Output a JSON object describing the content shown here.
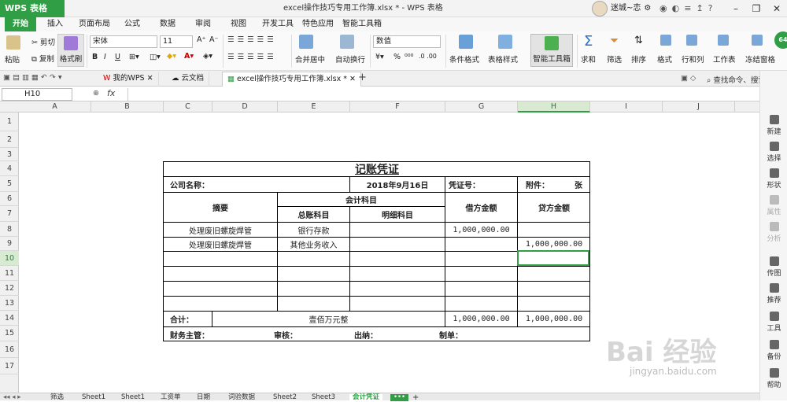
{
  "app": {
    "logo": "WPS 表格",
    "title": "excel操作技巧专用工作簿.xlsx * - WPS 表格",
    "user": "迷城~恋",
    "badge": "64"
  },
  "menu": [
    "开始",
    "插入",
    "页面布局",
    "公式",
    "数据",
    "审阅",
    "视图",
    "开发工具",
    "特色应用",
    "智能工具箱"
  ],
  "ribbon": {
    "paste": "粘贴",
    "cut": "剪切",
    "copy": "复制",
    "format_painter": "格式刷",
    "font_name": "宋体",
    "font_size": "11",
    "merge": "合并居中",
    "wrap": "自动换行",
    "number_format": "数值",
    "cond_format": "条件格式",
    "table_style": "表格样式",
    "smart_toolbox": "智能工具箱",
    "sum": "求和",
    "filter": "筛选",
    "sort": "排序",
    "format": "格式",
    "rowcol": "行和列",
    "worksheet": "工作表",
    "freeze": "冻结窗格"
  },
  "quicktabs": [
    "我的WPS",
    "云文档",
    "excel操作技巧专用工作簿.xlsx *"
  ],
  "search": "查找命令、搜索...",
  "formula": {
    "namebox": "H10",
    "fx": "fx"
  },
  "columns": [
    "A",
    "B",
    "C",
    "D",
    "E",
    "F",
    "G",
    "H",
    "I",
    "J"
  ],
  "rows": [
    "1",
    "2",
    "3",
    "4",
    "5",
    "6",
    "7",
    "8",
    "9",
    "10",
    "11",
    "12",
    "13",
    "14",
    "15",
    "16",
    "17"
  ],
  "voucher": {
    "title": "记账凭证",
    "company_label": "公司名称：",
    "date": "2018年9月16日",
    "voucher_no_label": "凭证号：",
    "attach_label": "附件：",
    "attach_unit": "张",
    "h_summary": "摘要",
    "h_account": "会计科目",
    "h_general": "总账科目",
    "h_detail": "明细科目",
    "h_debit": "借方金额",
    "h_credit": "贷方金额",
    "r1_summary": "处理废旧螺旋焊管",
    "r1_general": "银行存款",
    "r1_debit": "1,000,000.00",
    "r2_summary": "处理废旧螺旋焊管",
    "r2_general": "其他业务收入",
    "r2_credit": "1,000,000.00",
    "total_label": "合计：",
    "total_words": "壹佰万元整",
    "total_debit": "1,000,000.00",
    "total_credit": "1,000,000.00",
    "sig_manager": "财务主管：",
    "sig_audit": "审核：",
    "sig_cashier": "出纳：",
    "sig_maker": "制单："
  },
  "sidebar": [
    "新建",
    "选择",
    "形状",
    "属性",
    "分析",
    "传图",
    "推荐",
    "工具",
    "备份",
    "帮助"
  ],
  "sheets": [
    "筛选",
    "Sheet1",
    "Sheet1",
    "工资单",
    "日期",
    "词验数据",
    "Sheet2",
    "Sheet3",
    "会计凭证"
  ],
  "watermark": {
    "brand": "Bai 经验",
    "url": "jingyan.baidu.com"
  },
  "colors": {
    "accent": "#2f9e44"
  }
}
